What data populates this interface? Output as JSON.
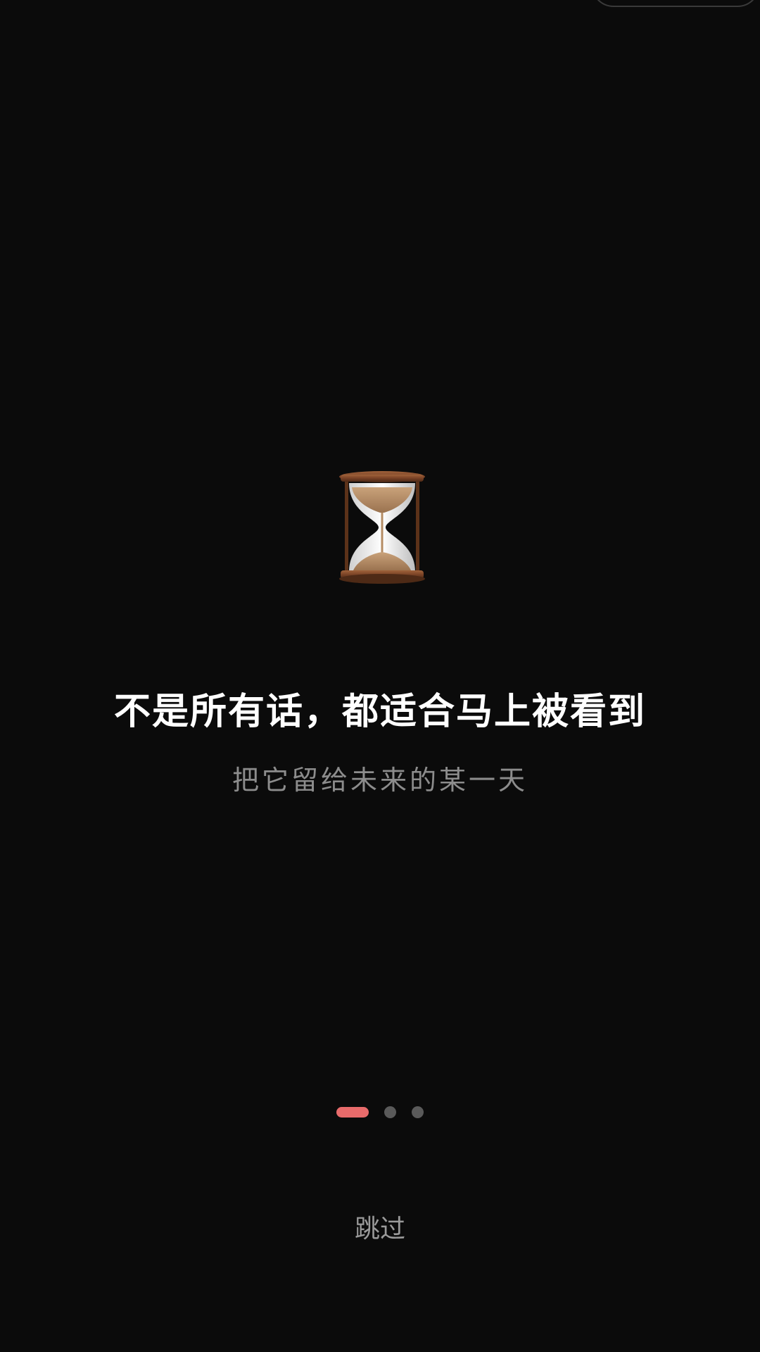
{
  "onboarding": {
    "icon": "hourglass-icon",
    "title": "不是所有话，都适合马上被看到",
    "subtitle": "把它留给未来的某一天",
    "pager": {
      "total": 3,
      "current": 1
    },
    "skip_label": "跳过"
  },
  "colors": {
    "background": "#0b0b0b",
    "title": "#ffffff",
    "subtitle": "#8c8c8c",
    "pager_active": "#e86b6b",
    "pager_inactive": "#5a5a5a",
    "skip": "#9a9a9a"
  }
}
